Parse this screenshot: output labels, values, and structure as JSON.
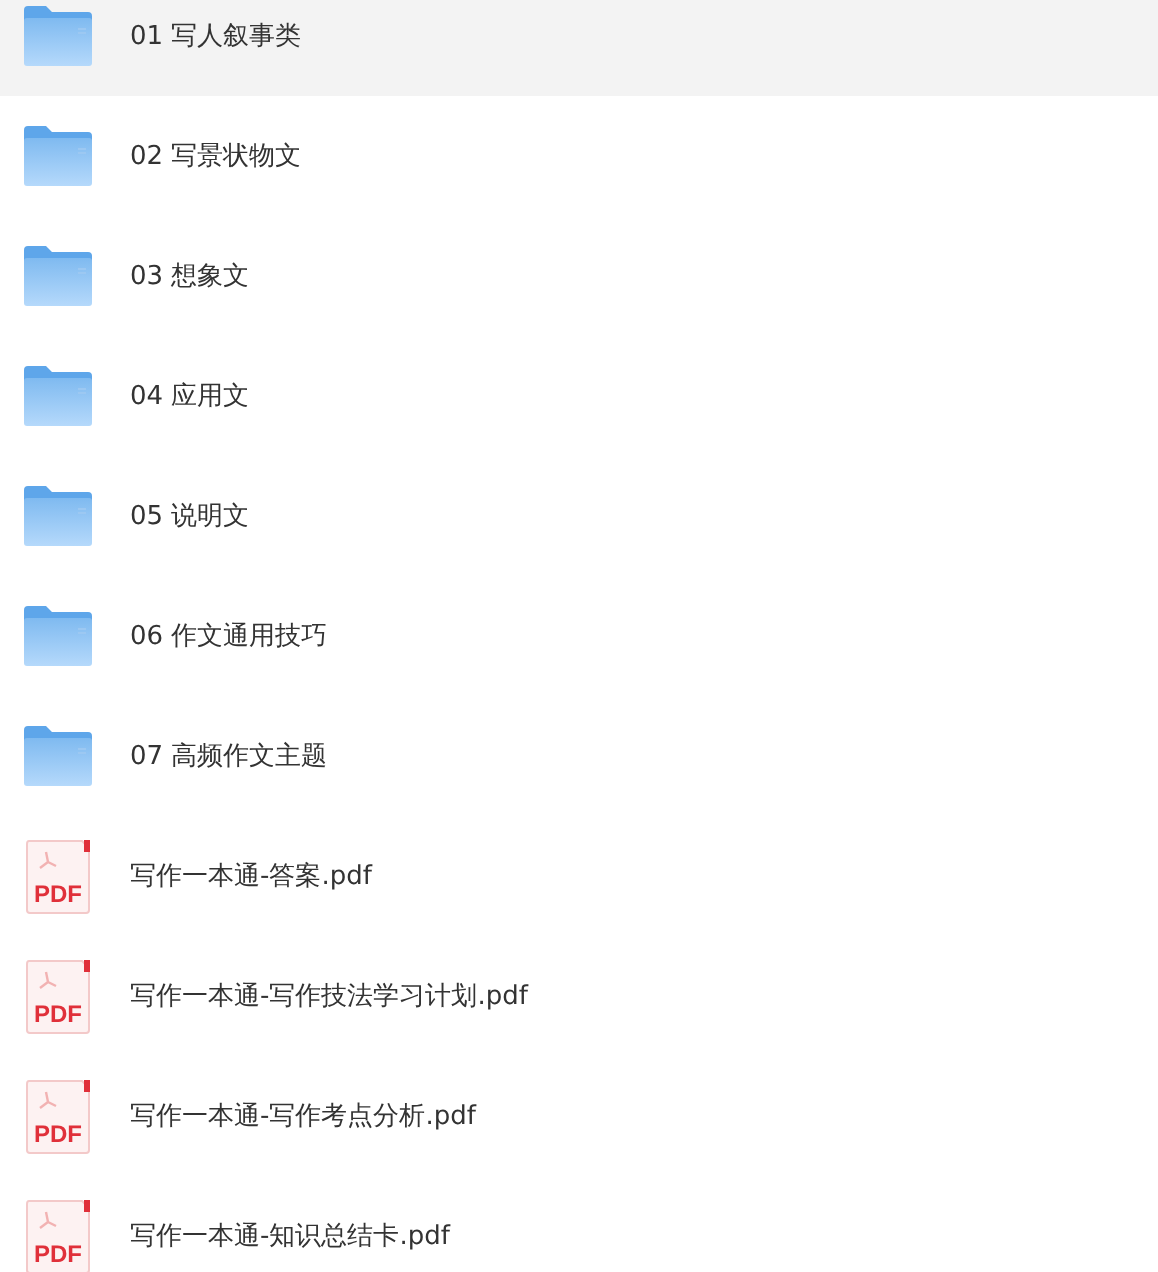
{
  "items": [
    {
      "kind": "folder",
      "name": "01 写人叙事类",
      "selected": true
    },
    {
      "kind": "folder",
      "name": "02 写景状物文",
      "selected": false
    },
    {
      "kind": "folder",
      "name": "03 想象文",
      "selected": false
    },
    {
      "kind": "folder",
      "name": "04 应用文",
      "selected": false
    },
    {
      "kind": "folder",
      "name": "05 说明文",
      "selected": false
    },
    {
      "kind": "folder",
      "name": "06 作文通用技巧",
      "selected": false
    },
    {
      "kind": "folder",
      "name": "07 高频作文主题",
      "selected": false
    },
    {
      "kind": "pdf",
      "name": "写作一本通-答案.pdf",
      "icon_label": "PDF",
      "selected": false
    },
    {
      "kind": "pdf",
      "name": "写作一本通-写作技法学习计划.pdf",
      "icon_label": "PDF",
      "selected": false
    },
    {
      "kind": "pdf",
      "name": "写作一本通-写作考点分析.pdf",
      "icon_label": "PDF",
      "selected": false
    },
    {
      "kind": "pdf",
      "name": "写作一本通-知识总结卡.pdf",
      "icon_label": "PDF",
      "selected": false
    }
  ]
}
